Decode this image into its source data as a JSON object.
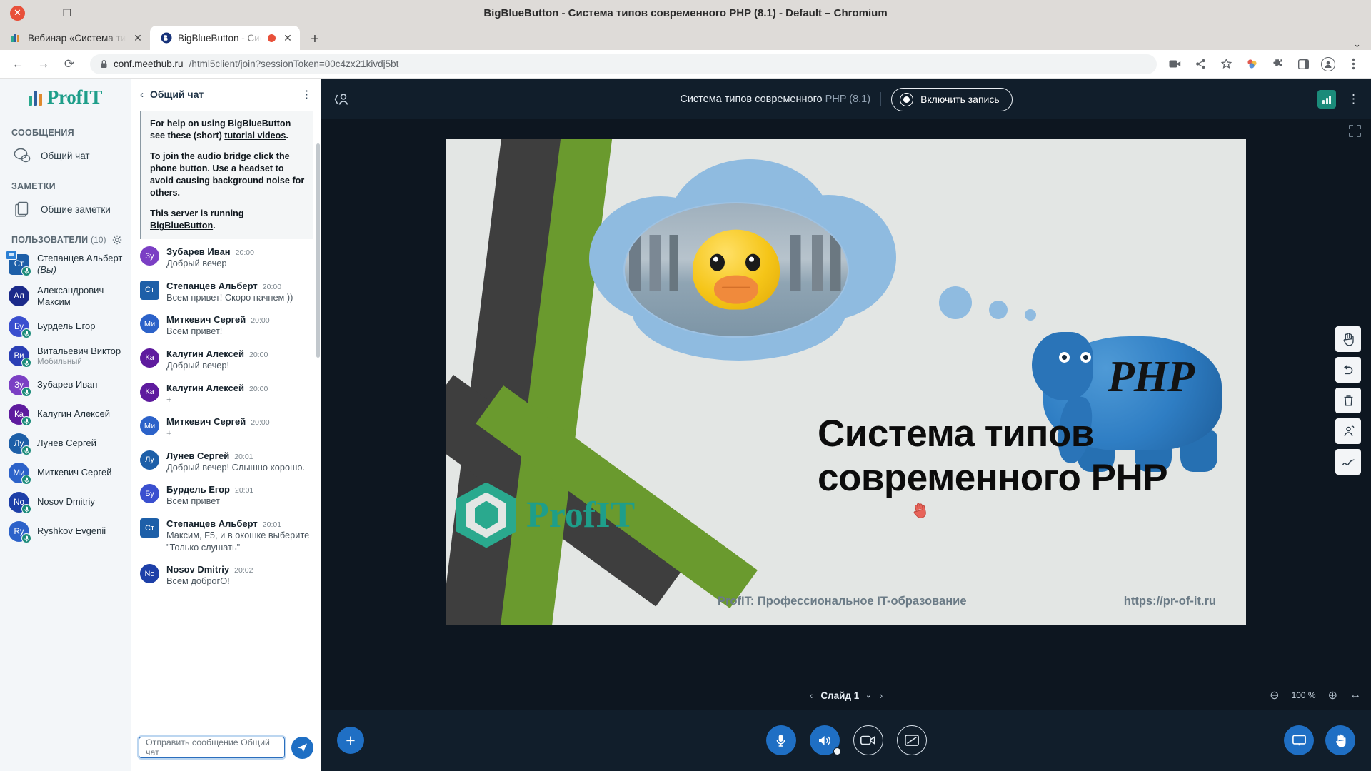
{
  "window": {
    "title": "BigBlueButton - Система типов современного PHP (8.1) - Default – Chromium",
    "close_glyph": "✕",
    "minimize_glyph": "–",
    "maximize_glyph": "❐"
  },
  "browser": {
    "tabs": [
      {
        "label": "Вебинар «Система типов",
        "favicon": "profit-icon",
        "active": false,
        "recording": false,
        "close_glyph": "✕"
      },
      {
        "label": "BigBlueButton - Систе",
        "favicon": "bbb-icon",
        "active": true,
        "recording": true,
        "close_glyph": "✕"
      }
    ],
    "new_tab_glyph": "+",
    "tabstrip_menu_glyph": "⌄",
    "back_glyph": "←",
    "forward_glyph": "→",
    "reload_glyph": "⟳",
    "lock_glyph": "🔒",
    "url_host": "conf.meethub.ru",
    "url_path": "/html5client/join?sessionToken=00c4zx21kivdj5bt",
    "toolbar_icons": [
      "camera-icon",
      "share-icon",
      "bookmark-star-icon",
      "extension-color-icon",
      "puzzle-extension-icon",
      "sidepanel-icon",
      "profile-avatar-icon",
      "browser-menu-icon"
    ]
  },
  "sidebar": {
    "brand": "ProfIT",
    "sections": [
      {
        "label": "СООБЩЕНИЯ",
        "count": ""
      },
      {
        "label": "ЗАМЕТКИ",
        "count": ""
      },
      {
        "label": "ПОЛЬЗОВАТЕЛИ",
        "count": "(10)"
      }
    ],
    "messages_item": {
      "label": "Общий чат",
      "icon": "chat-bubble-icon"
    },
    "notes_item": {
      "label": "Общие заметки",
      "icon": "notes-icon"
    },
    "users_gear_icon": "gear-icon",
    "users": [
      {
        "initials": "Ст",
        "name": "Степанцев Альберт",
        "suffix": " (Вы)",
        "sub": "",
        "color": "#1d5fa8",
        "moderator": true,
        "mic": true,
        "screenshare": true
      },
      {
        "initials": "Ал",
        "name": "Александрович Максим",
        "suffix": "",
        "sub": "",
        "color": "#1b2a8a",
        "moderator": false,
        "mic": false,
        "screenshare": false
      },
      {
        "initials": "Бу",
        "name": "Бурдель Егор",
        "suffix": "",
        "sub": "",
        "color": "#3a4fcf",
        "moderator": false,
        "mic": true,
        "screenshare": false
      },
      {
        "initials": "Ви",
        "name": "Витальевич Виктор",
        "suffix": "",
        "sub": "Мобильный",
        "color": "#2a3fb5",
        "moderator": false,
        "mic": true,
        "screenshare": false
      },
      {
        "initials": "Зу",
        "name": "Зубарев Иван",
        "suffix": "",
        "sub": "",
        "color": "#7b3fc4",
        "moderator": false,
        "mic": true,
        "screenshare": false
      },
      {
        "initials": "Ка",
        "name": "Калугин Алексей",
        "suffix": "",
        "sub": "",
        "color": "#5e1b9e",
        "moderator": false,
        "mic": true,
        "screenshare": false
      },
      {
        "initials": "Лу",
        "name": "Лунев Сергей",
        "suffix": "",
        "sub": "",
        "color": "#1d5fa8",
        "moderator": false,
        "mic": true,
        "screenshare": false
      },
      {
        "initials": "Ми",
        "name": "Миткевич Сергей",
        "suffix": "",
        "sub": "",
        "color": "#2c62c9",
        "moderator": false,
        "mic": true,
        "screenshare": false
      },
      {
        "initials": "No",
        "name": "Nosov Dmitriy",
        "suffix": "",
        "sub": "",
        "color": "#1d3fa8",
        "moderator": false,
        "mic": true,
        "screenshare": false
      },
      {
        "initials": "Ry",
        "name": "Ryshkov Evgenii",
        "suffix": "",
        "sub": "",
        "color": "#2c62c9",
        "moderator": false,
        "mic": true,
        "screenshare": false
      }
    ]
  },
  "chat": {
    "title": "Общий чат",
    "back_glyph": "‹",
    "kebab_glyph": "⋮",
    "welcome": [
      {
        "pre": "For help on using BigBlueButton see these (short) ",
        "link": "tutorial videos",
        "post": "."
      },
      {
        "pre": "To join the audio bridge click the phone button. Use a headset to avoid causing background noise for others.",
        "link": "",
        "post": ""
      },
      {
        "pre": "This server is running ",
        "link": "BigBlueButton",
        "post": "."
      }
    ],
    "messages": [
      {
        "initials": "Зу",
        "name": "Зубарев Иван",
        "time": "20:00",
        "text": "Добрый вечер",
        "color": "#7b3fc4",
        "moderator": false
      },
      {
        "initials": "Ст",
        "name": "Степанцев Альберт",
        "time": "20:00",
        "text": "Всем привет! Скоро начнем ))",
        "color": "#1d5fa8",
        "moderator": true
      },
      {
        "initials": "Ми",
        "name": "Миткевич Сергей",
        "time": "20:00",
        "text": "Всем привет!",
        "color": "#2c62c9",
        "moderator": false
      },
      {
        "initials": "Ка",
        "name": "Калугин Алексей",
        "time": "20:00",
        "text": "Добрый вечер!",
        "color": "#5e1b9e",
        "moderator": false
      },
      {
        "initials": "Ка",
        "name": "Калугин Алексей",
        "time": "20:00",
        "text": "+",
        "color": "#5e1b9e",
        "moderator": false
      },
      {
        "initials": "Ми",
        "name": "Миткевич Сергей",
        "time": "20:00",
        "text": "+",
        "color": "#2c62c9",
        "moderator": false
      },
      {
        "initials": "Лу",
        "name": "Лунев Сергей",
        "time": "20:01",
        "text": "Добрый вечер! Слышно хорошо.",
        "color": "#1d5fa8",
        "moderator": false
      },
      {
        "initials": "Бу",
        "name": "Бурдель Егор",
        "time": "20:01",
        "text": "Всем привет",
        "color": "#3a4fcf",
        "moderator": false
      },
      {
        "initials": "Ст",
        "name": "Степанцев Альберт",
        "time": "20:01",
        "text": "Максим, F5, и в окошке выберите \"Только слушать\"",
        "color": "#1d5fa8",
        "moderator": true
      },
      {
        "initials": "No",
        "name": "Nosov Dmitriy",
        "time": "20:02",
        "text": "Всем доброгО!",
        "color": "#1d3fa8",
        "moderator": false
      }
    ],
    "input_placeholder": "Отправить сообщение Общий чат",
    "send_icon": "send-paper-plane-icon"
  },
  "meeting": {
    "user_list_toggle_icon": "user-list-toggle-icon",
    "title_main": "Система типов современного ",
    "title_dim": "PHP (8.1)",
    "record_button": "Включить запись",
    "connection_icon": "connection-status-icon",
    "options_kebab": "⋮",
    "presenter_badge": "Степанцев Альберт",
    "presenter_badge_icon": "presenter-icon"
  },
  "slide": {
    "title_line1": "Система типов",
    "title_line2": "современного PHP",
    "brand": "ProfIT",
    "footer_left": "ProfIT: Профессиональное IT-образование",
    "footer_right": "https://pr-of-it.ru",
    "php_word": "PHP",
    "expand_icon": "fullscreen-icon",
    "cursor_icon": "presenter-hand-cursor"
  },
  "presentation_tools": [
    {
      "icon": "pan-hand-icon",
      "name": "pan-tool"
    },
    {
      "icon": "undo-arrow-icon",
      "name": "undo-tool"
    },
    {
      "icon": "trash-icon",
      "name": "delete-annotations-tool"
    },
    {
      "icon": "multi-user-whiteboard-icon",
      "name": "multi-user-whiteboard-tool"
    },
    {
      "icon": "pencil-line-icon",
      "name": "pencil-tool"
    }
  ],
  "slidebar": {
    "prev_glyph": "‹",
    "next_glyph": "›",
    "current_slide": "Слайд 1",
    "chevron_glyph": "⌄",
    "zoom_out_glyph": "⊖",
    "zoom_in_glyph": "⊕",
    "zoom_level": "100 %",
    "fit_width_glyph": "↔"
  },
  "actionbar": {
    "plus_glyph": "+",
    "buttons": [
      {
        "name": "mute-microphone-button",
        "icon": "microphone-icon",
        "style": "filled"
      },
      {
        "name": "leave-audio-button",
        "icon": "speaker-icon",
        "style": "filled",
        "muted_dot": true
      },
      {
        "name": "share-webcam-button",
        "icon": "webcam-icon",
        "style": "outline"
      },
      {
        "name": "stop-screenshare-button",
        "icon": "screenshare-stop-icon",
        "style": "outline"
      }
    ],
    "right_buttons": [
      {
        "name": "presentation-toggle-button",
        "icon": "presentation-icon"
      },
      {
        "name": "raise-hand-button",
        "icon": "raise-hand-icon"
      }
    ]
  }
}
